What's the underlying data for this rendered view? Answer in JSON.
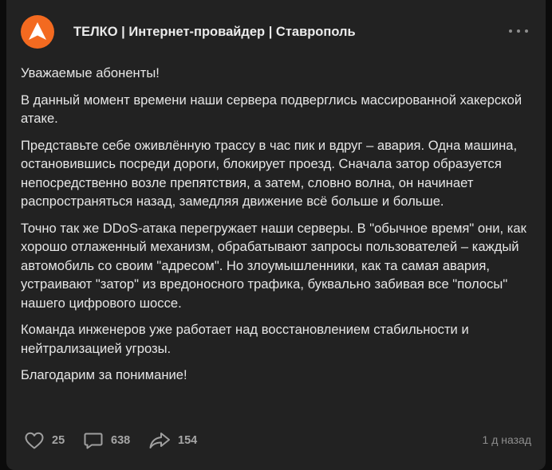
{
  "channel": {
    "name": "ТЕЛКО | Интернет-провайдер | Ставрополь",
    "avatar_icon": "telko-logo-icon",
    "brand_color": "#f36a20"
  },
  "post": {
    "paragraphs": [
      "Уважаемые абоненты!",
      "В данный момент времени наши сервера подверглись массированной хакерской атаке.",
      "Представьте себе оживлённую трассу в час пик и вдруг – авария. Одна машина, остановившись посреди дороги, блокирует проезд. Сначала затор образуется непосредственно возле препятствия, а затем, словно волна, он начинает распространяться назад, замедляя движение всё больше и больше.",
      "Точно так же DDoS-атака перегружает наши серверы. В \"обычное время\" они, как хорошо отлаженный механизм, обрабатывают запросы пользователей – каждый автомобиль со своим \"адресом\". Но злоумышленники, как та самая авария, устраивают \"затор\" из вредоносного трафика, буквально забивая все \"полосы\" нашего цифрового шоссе.",
      "Команда инженеров уже работает над восстановлением стабильности и нейтрализацией угрозы.",
      "Благодарим за понимание!"
    ]
  },
  "footer": {
    "likes": "25",
    "comments": "638",
    "shares": "154",
    "timestamp": "1 д назад",
    "like_icon": "heart-icon",
    "comment_icon": "comment-icon",
    "share_icon": "share-icon"
  },
  "menu_icon": "more-dots-icon"
}
